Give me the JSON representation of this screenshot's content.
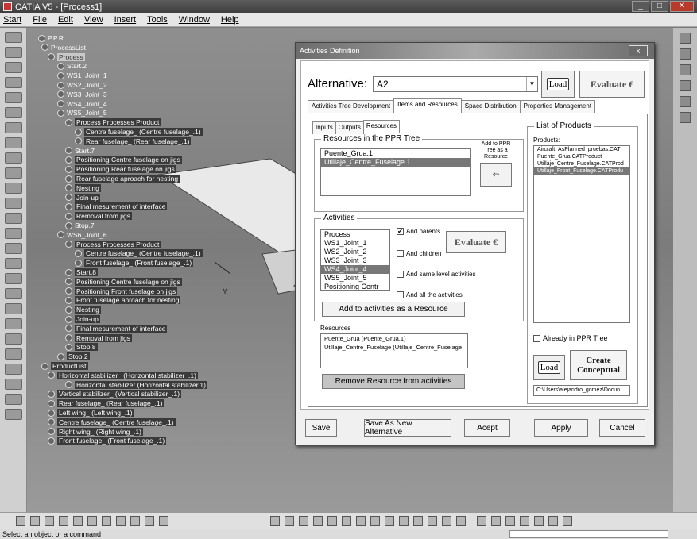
{
  "window": {
    "title": "CATIA V5 - [Process1]"
  },
  "menu": [
    "Start",
    "File",
    "Edit",
    "View",
    "Insert",
    "Tools",
    "Window",
    "Help"
  ],
  "tree": {
    "root": "P.P.R.",
    "process_list": "ProcessList",
    "process": "Process",
    "items": [
      "Start.2",
      "WS1_Joint_1",
      "WS2_Joint_2",
      "WS3_Joint_3",
      "WS4_Joint_4",
      "WS5_Joint_5",
      "Process Processes Product",
      "Centre fuselage_ (Centre fuselage_.1)",
      "Rear fuselage_ (Rear fuselage_.1)",
      "Start.7",
      "Positioning Centre fuselage on jigs",
      "Positioning Rear fuselage on jigs",
      "Rear fuselage aproach  for nesting",
      "Nesting",
      "Join-up",
      "Final mesurement of interface",
      "Removal from jigs",
      "Stop.7",
      "WS6_Joint_6",
      "Process Processes Product",
      "Centre fuselage_ (Centre fuselage_.1)",
      "Front fuselage_ (Front fuselage_.1)",
      "Start.8",
      "Positioning Centre fuselage on jigs",
      "Positioning Front fuselage on jigs",
      "Front fuselage aproach  for nesting",
      "Nesting",
      "Join-up",
      "Final mesurement of interface",
      "Removal from jigs",
      "Stop.8",
      "Stop.2",
      "ProductList",
      "Horizontal stabilizer_ (Horizontal stabilizer_.1)",
      "Horizontal stabilizer (Horizontal stabilizer.1)",
      "Vertical stabilizer_ (Vertical stabilizer_.1)",
      "Rear fuselage_ (Rear fuselage_.1)",
      "Left wing_ (Left wing_.1)",
      "Centre fuselage_ (Centre fuselage_.1)",
      "Right wing_ (Right wing_.1)",
      "Front fuselage_ (Front fuselage_.1)"
    ]
  },
  "dialog": {
    "title": "Activities Definition",
    "close": "x",
    "alternative_label": "Alternative:",
    "alternative_value": "A2",
    "load": "Load",
    "evaluate": "Evaluate €",
    "tabs": [
      "Activities Tree Development",
      "Items and Resources",
      "Space Distribution",
      "Properties Management"
    ],
    "subtabs": [
      "Inputs",
      "Outputs",
      "Resources"
    ],
    "resources_group": "Resources in the PPR Tree",
    "resources": [
      "Puente_Grua.1",
      "Utillaje_Centre_Fuselage.1"
    ],
    "add_to_ppr": "Add to PPR Tree as a Resource",
    "activities_group": "Activities",
    "activities": [
      "Process",
      "WS1_Joint_1",
      "WS2_Joint_2",
      "WS3_Joint_3",
      "WS4_Joint_4",
      "WS5_Joint_5",
      "Positioning Centr"
    ],
    "and_parents": "And parents",
    "and_children": "And children",
    "and_same_level": "And same level activities",
    "and_all": "And all the activities",
    "add_activities_btn": "Add to activities as a Resource",
    "resources_label": "Resources",
    "resource_links": [
      "Puente_Grua (Puente_Grua.1)",
      "Utillaje_Centre_Fuselage (Utillaje_Centre_Fuselage"
    ],
    "remove_btn": "Remove Resource from activities",
    "products_group": "List of Products",
    "products_label": "Products:",
    "products": [
      "Aircraft_AsPlanned_pruebas.CAT",
      "Puente_Grua.CATProduct",
      "Utillaje_Centre_Fuselage.CATProd",
      "Utillaje_Front_Fuselage.CATProdu"
    ],
    "already_in_ppr": "Already in PPR Tree",
    "create_conceptual": "Create Conceptual",
    "path": "C:\\Users\\alejandro_gomez\\Docun",
    "footer": {
      "save": "Save",
      "save_as": "Save As New Alternative",
      "accept": "Acept",
      "apply": "Apply",
      "cancel": "Cancel"
    }
  },
  "status": "Select an object or a command"
}
